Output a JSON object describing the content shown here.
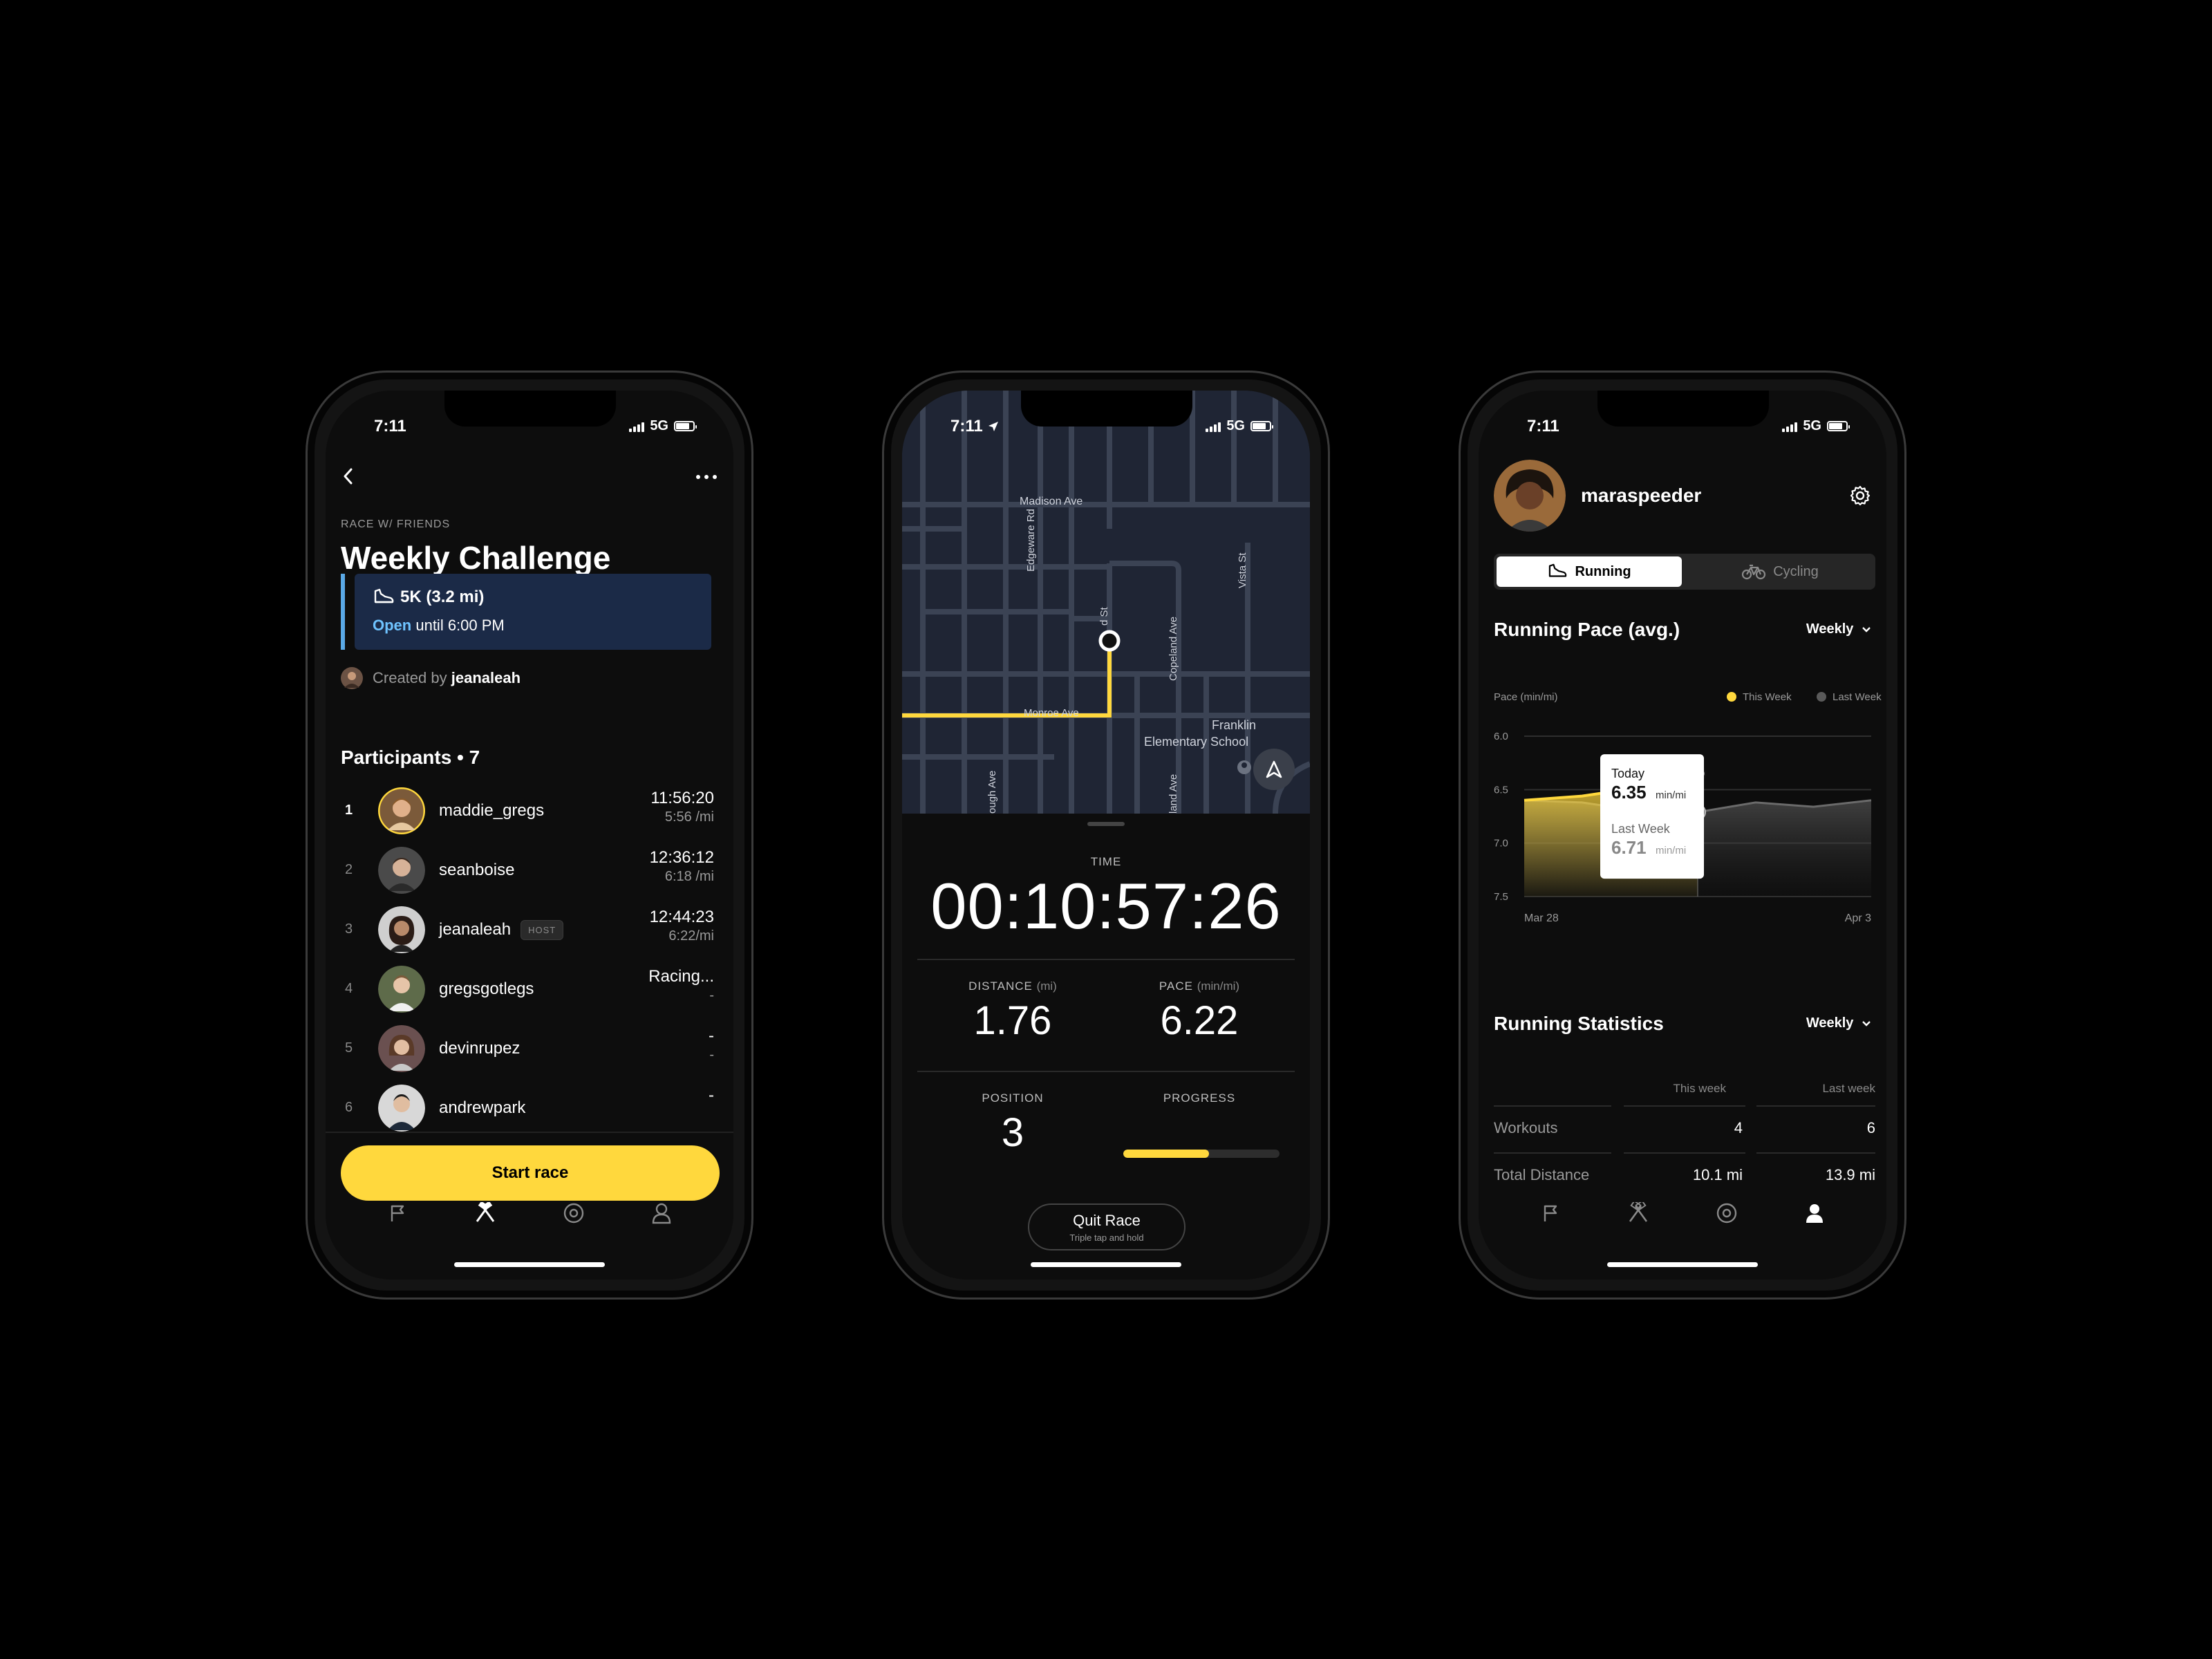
{
  "phone1": {
    "status_time": "7:11",
    "network": "5G",
    "eyebrow": "RACE W/ FRIENDS",
    "title": "Weekly Challenge",
    "race_distance": "5K (3.2 mi)",
    "race_open": "Open",
    "race_until": " until 6:00 PM",
    "created_by_label": "Created by",
    "created_by_user": "jeanaleah",
    "participants_heading": "Participants • 7",
    "participants": [
      {
        "rank": "1",
        "name": "maddie_gregs",
        "time": "11:56:20",
        "pace": "5:56 /mi",
        "host": ""
      },
      {
        "rank": "2",
        "name": "seanboise",
        "time": "12:36:12",
        "pace": "6:18 /mi",
        "host": ""
      },
      {
        "rank": "3",
        "name": "jeanaleah",
        "time": "12:44:23",
        "pace": "6:22/mi",
        "host": "HOST"
      },
      {
        "rank": "4",
        "name": "gregsgotlegs",
        "time": "Racing...",
        "pace": "-",
        "host": ""
      },
      {
        "rank": "5",
        "name": "devinrupez",
        "time": "-",
        "pace": "-",
        "host": ""
      },
      {
        "rank": "6",
        "name": "andrewpark",
        "time": "-",
        "pace": "",
        "host": ""
      }
    ],
    "start_button": "Start race",
    "tabs": [
      "flag-icon",
      "race-flags-icon",
      "target-icon",
      "person-icon"
    ],
    "active_tab": 1
  },
  "phone2": {
    "status_time": "7:11",
    "network": "5G",
    "map_labels": {
      "madison": "Madison Ave",
      "edgeware": "Edgeware Rd",
      "vista": "Vista St",
      "copeland": "Copeland Ave",
      "monroe": "Monroe Ave",
      "franklin_1": "Franklin",
      "franklin_2": "Elementary School",
      "partial_st": "d St",
      "partial_ave1": "ough Ave",
      "partial_ave2": "land Ave"
    },
    "time_label": "TIME",
    "time_value": "00:10:57:26",
    "distance_label": "DISTANCE",
    "distance_unit": "(mi)",
    "distance_value": "1.76",
    "pace_label": "PACE",
    "pace_unit": "(min/mi)",
    "pace_value": "6.22",
    "position_label": "POSITION",
    "position_value": "3",
    "progress_label": "PROGRESS",
    "progress_fraction": 0.55,
    "quit_label": "Quit Race",
    "quit_hint": "Triple tap and hold",
    "accent": "#ffd83d"
  },
  "phone3": {
    "status_time": "7:11",
    "network": "5G",
    "username": "maraspeeder",
    "seg_running": "Running",
    "seg_cycling": "Cycling",
    "pace_heading": "Running Pace (avg.)",
    "pace_period": "Weekly",
    "stats_heading": "Running Statistics",
    "stats_period": "Weekly",
    "tooltip": {
      "today_label": "Today",
      "today_value": "6.35",
      "today_unit": "min/mi",
      "lastweek_label": "Last Week",
      "lastweek_value": "6.71",
      "lastweek_unit": "min/mi"
    },
    "chart_data": {
      "type": "area",
      "ylabel": "Pace (min/mi)",
      "y_ticks": [
        "6.0",
        "6.5",
        "7.0",
        "7.5"
      ],
      "ylim": [
        6.0,
        7.5
      ],
      "y_inverted": true,
      "x_ticks": [
        "Mar 28",
        "Apr 3"
      ],
      "legend": [
        "This Week",
        "Last Week"
      ],
      "legend_position": "top-right",
      "grid": true,
      "series": [
        {
          "name": "This Week",
          "color": "#ffd83d",
          "x": [
            0,
            1,
            2,
            3
          ],
          "values": [
            6.6,
            6.56,
            6.48,
            6.35
          ]
        },
        {
          "name": "Last Week",
          "color": "#5a5a5a",
          "x": [
            0,
            1,
            2,
            3,
            4,
            5,
            6
          ],
          "values": [
            6.6,
            6.62,
            6.7,
            6.71,
            6.62,
            6.66,
            6.6
          ]
        }
      ]
    },
    "table": {
      "col_this": "This week",
      "col_last": "Last week",
      "rows": [
        {
          "label": "Workouts",
          "this": "4",
          "last": "6"
        },
        {
          "label": "Total Distance",
          "this": "10.1 mi",
          "last": "13.9 mi"
        }
      ]
    },
    "tabs": [
      "flag-icon",
      "race-flags-icon",
      "target-icon",
      "person-icon"
    ],
    "active_tab": 3
  }
}
